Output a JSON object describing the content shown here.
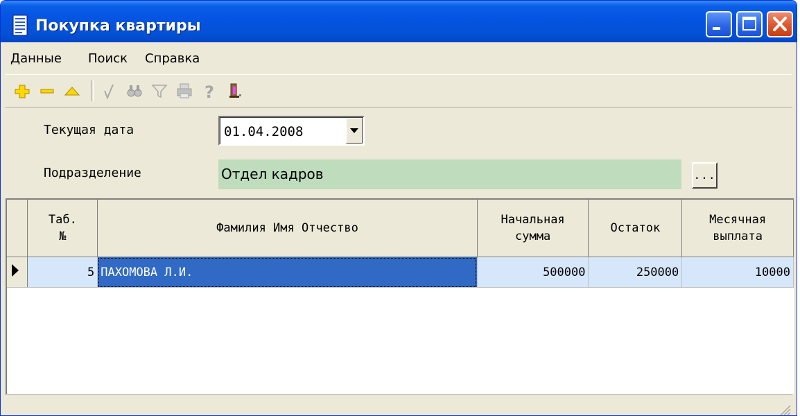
{
  "window": {
    "title": "Покупка квартиры",
    "title_bar_color": "#0554e3"
  },
  "menu": [
    {
      "label": "Данные"
    },
    {
      "label": "Поиск"
    },
    {
      "label": "Справка"
    }
  ],
  "toolbar": {
    "tools": [
      "add-icon",
      "delete-icon",
      "edit-icon",
      "confirm-icon",
      "find-icon",
      "filter-icon",
      "print-icon",
      "help-icon",
      "exit-icon"
    ]
  },
  "form": {
    "date_label": "Текущая дата",
    "date_value": "01.04.2008",
    "dept_label": "Подразделение",
    "dept_value": "Отдел кадров",
    "dept_button": "...",
    "dept_field_color": "#bfddbd"
  },
  "table": {
    "columns": [
      {
        "line1": "Таб.",
        "line2": "№"
      },
      {
        "line1": "Фамилия Имя Отчество",
        "line2": ""
      },
      {
        "line1": "Начальная",
        "line2": "сумма"
      },
      {
        "line1": "Остаток",
        "line2": ""
      },
      {
        "line1": "Месячная",
        "line2": "выплата"
      }
    ],
    "rows": [
      {
        "tab": "5",
        "name": "ПАХОМОВА Л.И.",
        "initial": "500000",
        "remaining": "250000",
        "monthly": "10000"
      }
    ],
    "selection_color": "#316ac5",
    "row_color": "#d6e6fb"
  }
}
